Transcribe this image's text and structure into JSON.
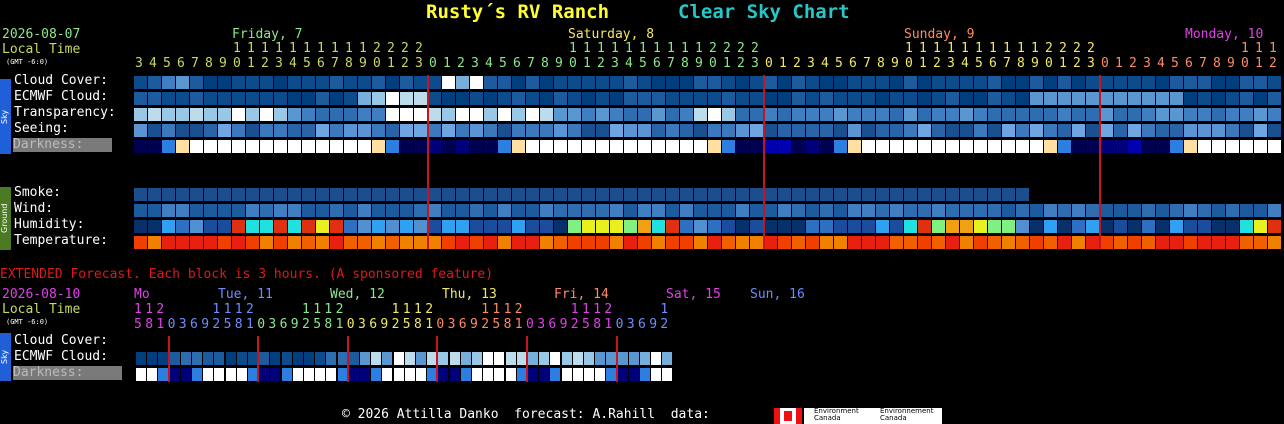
{
  "header": {
    "site_name": "Rusty´s RV Ranch",
    "chart_name": "Clear Sky Chart"
  },
  "main": {
    "date": "2026-08-07",
    "local_time_label": "Local Time",
    "gmt_label": "(GMT -6:0)",
    "days": [
      {
        "label": "Friday, 7",
        "color": "#8ce88c"
      },
      {
        "label": "Saturday, 8",
        "color": "#f2e866"
      },
      {
        "label": "Sunday, 9",
        "color": "#ff8a66"
      },
      {
        "label": "Monday, 10",
        "color": "#e040e8"
      }
    ],
    "hour_colors": [
      "#c8d860",
      "#8ce88c",
      "#f2e866",
      "#ff8a66",
      "#e040e8"
    ],
    "hours": [
      3,
      4,
      5,
      6,
      7,
      8,
      9,
      10,
      11,
      12,
      13,
      14,
      15,
      16,
      17,
      18,
      19,
      20,
      21,
      22,
      23,
      0,
      1,
      2,
      3,
      4,
      5,
      6,
      7,
      8,
      9,
      10,
      11,
      12,
      13,
      14,
      15,
      16,
      17,
      18,
      19,
      20,
      21,
      22,
      23,
      0,
      1,
      2,
      3,
      4,
      5,
      6,
      7,
      8,
      9,
      10,
      11,
      12,
      13,
      14,
      15,
      16,
      17,
      18,
      19,
      20,
      21,
      22,
      23,
      0,
      1,
      2,
      3,
      4,
      5,
      6,
      7,
      8,
      9,
      10,
      11,
      12
    ],
    "sky_side_label": "Sky",
    "ground_side_label": "Ground",
    "rows": {
      "cloud_cover": "Cloud Cover:",
      "ecmwf_cloud": "ECMWF Cloud:",
      "transparency": "Transparency:",
      "seeing": "Seeing:",
      "darkness": "Darkness:",
      "smoke": "Smoke:",
      "wind": "Wind:",
      "humidity": "Humidity:",
      "temperature": "Temperature:"
    }
  },
  "extended": {
    "notice": "EXTENDED Forecast. Each block is 3 hours. (A sponsored feature)",
    "date": "2026-08-10",
    "local_time_label": "Local Time",
    "gmt_label": "(GMT -6:0)",
    "days": [
      {
        "label": "Mo",
        "color": "#e040e8"
      },
      {
        "label": "Tue, 11",
        "color": "#6f8cff"
      },
      {
        "label": "Wed, 12",
        "color": "#8ce88c"
      },
      {
        "label": "Thu, 13",
        "color": "#f2e866"
      },
      {
        "label": "Fri, 14",
        "color": "#ff8a66"
      },
      {
        "label": "Sat, 15",
        "color": "#e040e8"
      },
      {
        "label": "Sun, 16",
        "color": "#6f8cff"
      }
    ],
    "hours": [
      15,
      18,
      21,
      0,
      3,
      6,
      9,
      12,
      15,
      18,
      21,
      0,
      3,
      6,
      9,
      12,
      15,
      18,
      21,
      0,
      3,
      6,
      9,
      12,
      15,
      18,
      21,
      0,
      3,
      6,
      9,
      12,
      15,
      18,
      21,
      0,
      3,
      6,
      9,
      12,
      15,
      18,
      21,
      0,
      3,
      6,
      9,
      12
    ],
    "sky_side_label": "Sky",
    "rows": {
      "cloud_cover": "Cloud Cover:",
      "ecmwf_cloud": "ECMWF Cloud:",
      "darkness": "Darkness:"
    }
  },
  "footer": {
    "credit": "© 2026 Attilla Danko  forecast: A.Rahill  data:",
    "env_canada_en": "Environment\nCanada",
    "env_canada_fr": "Environnement\nCanada"
  },
  "colors": {
    "title": "#ffff33",
    "chart_name": "#24c8c8",
    "date": "#8ce88c",
    "local_time": "#c8d860",
    "extended_notice": "#e01818",
    "day_separator": "#c8141e"
  }
}
